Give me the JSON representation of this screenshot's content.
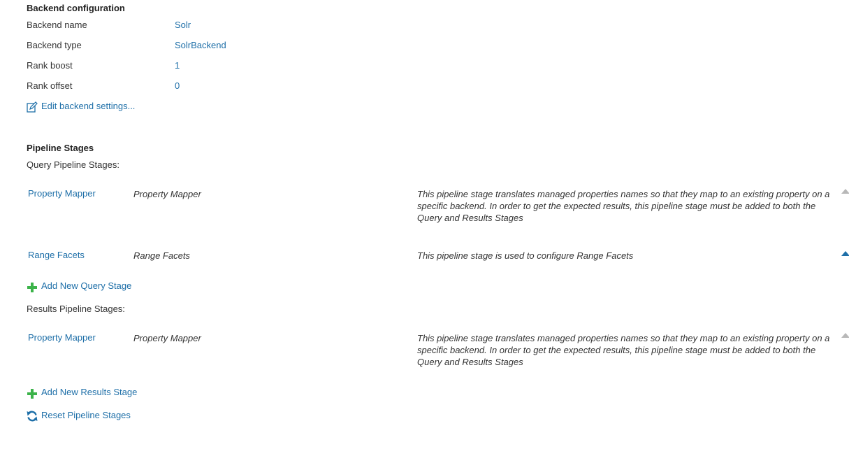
{
  "backend": {
    "heading": "Backend configuration",
    "fields": [
      {
        "label": "Backend name",
        "value": "Solr"
      },
      {
        "label": "Backend type",
        "value": "SolrBackend"
      },
      {
        "label": "Rank boost",
        "value": "1"
      },
      {
        "label": "Rank offset",
        "value": "0"
      }
    ],
    "edit_link": "Edit backend settings..."
  },
  "pipeline": {
    "heading": "Pipeline Stages",
    "query_label": "Query Pipeline Stages:",
    "query_stages": [
      {
        "name": "Property Mapper",
        "type": "Property Mapper",
        "description": "This pipeline stage translates managed properties names so that they map to an existing property on a specific backend. In order to get the expected results, this pipeline stage must be added to both the Query and Results Stages",
        "icon": "move-up-icon",
        "color": "#b8b8b8"
      },
      {
        "name": "Range Facets",
        "type": "Range Facets",
        "description": "This pipeline stage is used to configure Range Facets",
        "icon": "move-up-icon",
        "color": "#1e6fa8"
      }
    ],
    "add_query_stage": "Add New Query Stage",
    "results_label": "Results Pipeline Stages:",
    "results_stages": [
      {
        "name": "Property Mapper",
        "type": "Property Mapper",
        "description": "This pipeline stage translates managed properties names so that they map to an existing property on a specific backend. In order to get the expected results, this pipeline stage must be added to both the Query and Results Stages",
        "icon": "move-up-icon",
        "color": "#b8b8b8"
      }
    ],
    "add_results_stage": "Add New Results Stage",
    "reset": "Reset Pipeline Stages"
  },
  "colors": {
    "link": "#1e6fa8",
    "add_icon": "#3cb34a",
    "reset_icon": "#1e6fa8"
  }
}
